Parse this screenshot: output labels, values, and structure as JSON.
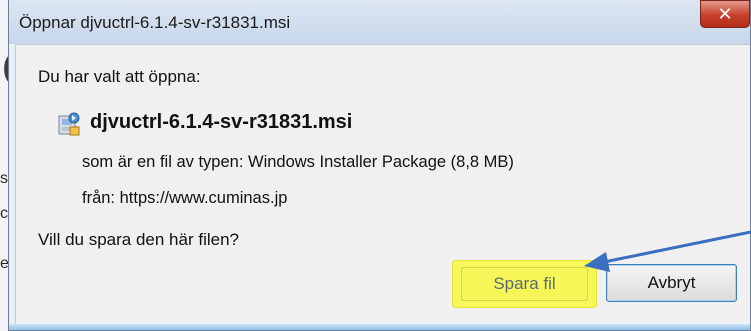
{
  "background": {
    "big_letter": "C",
    "side_letters": [
      "s",
      "c",
      "e"
    ]
  },
  "dialog": {
    "title": "Öppnar djvuctrl-6.1.4-sv-r31831.msi",
    "close_glyph": "✕",
    "intro": "Du har valt att öppna:",
    "file_icon": "msi-installer-icon",
    "file_name": "djvuctrl-6.1.4-sv-r31831.msi",
    "type_line": "som är en fil av typen:  Windows Installer Package (8,8 MB)",
    "from_line": "från:  https://www.cuminas.jp",
    "question": "Vill du spara den här filen?",
    "save_label": "Spara fil",
    "cancel_label": "Avbryt"
  },
  "colors": {
    "highlight": "#f6f658",
    "arrow": "#3a6fc0",
    "close_red": "#c7402b"
  }
}
